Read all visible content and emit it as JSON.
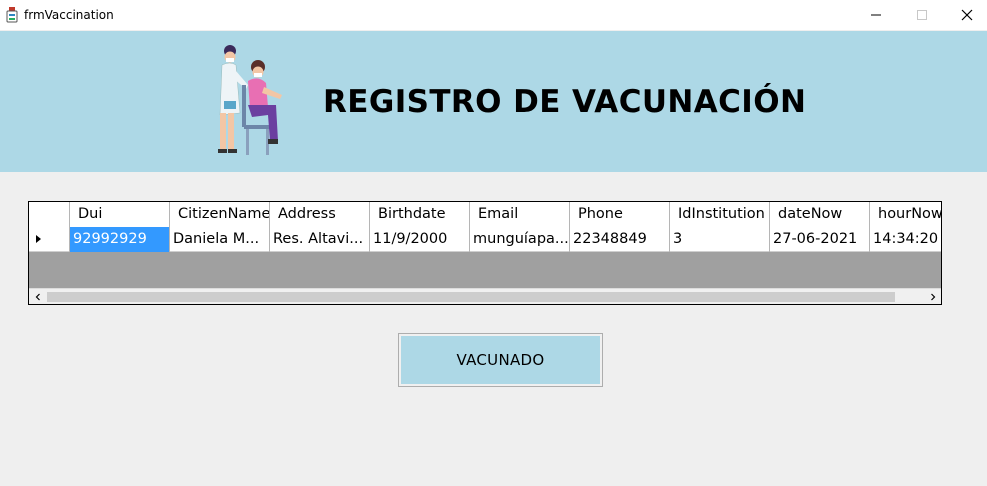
{
  "window": {
    "title": "frmVaccination"
  },
  "banner": {
    "title": "REGISTRO DE VACUNACIÓN",
    "background": "#add8e6"
  },
  "grid": {
    "columns": [
      "Dui",
      "CitizenName",
      "Address",
      "Birthdate",
      "Email",
      "Phone",
      "IdInstitution",
      "dateNow",
      "hourNow"
    ],
    "rows": [
      {
        "Dui": "92992929",
        "CitizenName": "Daniela M...",
        "Address": "Res. Altavi...",
        "Birthdate": "11/9/2000",
        "Email": "munguíapa...",
        "Phone": "22348849",
        "IdInstitution": "3",
        "dateNow": "27-06-2021",
        "hourNow": "14:34:20"
      }
    ],
    "selected_cell": "Dui",
    "selection_color": "#3399ff"
  },
  "actions": {
    "vacunado_label": "VACUNADO"
  },
  "icons": {
    "app": "vaccine-app-icon",
    "minimize": "minimize-icon",
    "maximize": "maximize-icon",
    "close": "close-icon",
    "illustration": "vaccination-illustration",
    "row_indicator": "row-pointer-icon",
    "scroll_left": "scroll-left-icon",
    "scroll_right": "scroll-right-icon"
  }
}
